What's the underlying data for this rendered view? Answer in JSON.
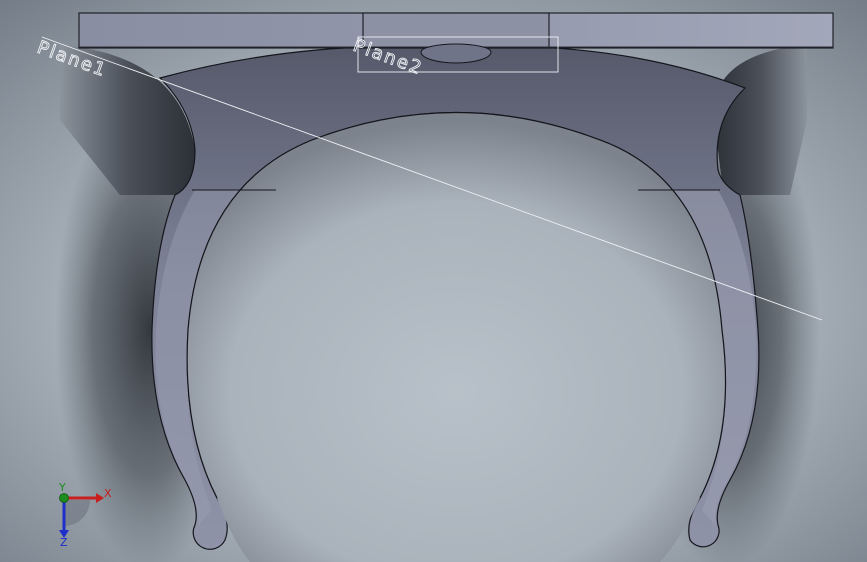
{
  "viewport": {
    "background_center": "#b9c1ca",
    "background_edge": "#6d7680",
    "part_color": "#8d91a6",
    "edge_color": "#15161c"
  },
  "planes": [
    {
      "label": "Plane1"
    },
    {
      "label": "Plane2"
    }
  ],
  "triad": {
    "x_label": "X",
    "y_label": "Y",
    "z_label": "Z",
    "x_color": "#c81e1e",
    "y_color": "#1e8c1e",
    "z_color": "#1e2ec8"
  }
}
